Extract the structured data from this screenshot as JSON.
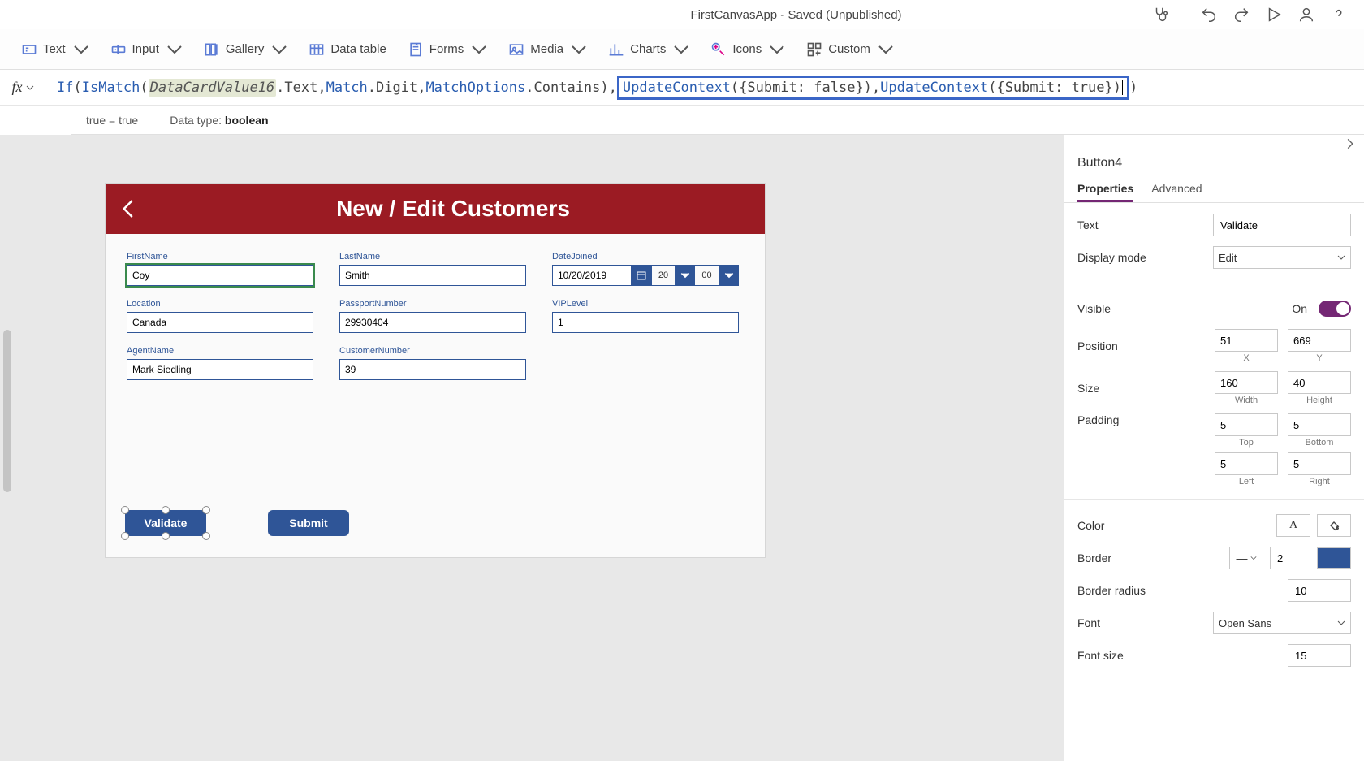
{
  "titlebar": {
    "title": "FirstCanvasApp - Saved (Unpublished)",
    "icons": [
      "stethoscope-icon",
      "undo-icon",
      "redo-icon",
      "play-icon",
      "user-icon",
      "help-icon"
    ]
  },
  "ribbon": {
    "items": [
      {
        "label": "Text",
        "icon": "text-icon"
      },
      {
        "label": "Input",
        "icon": "input-icon"
      },
      {
        "label": "Gallery",
        "icon": "gallery-icon"
      },
      {
        "label": "Data table",
        "icon": "datatable-icon"
      },
      {
        "label": "Forms",
        "icon": "forms-icon"
      },
      {
        "label": "Media",
        "icon": "media-icon"
      },
      {
        "label": "Charts",
        "icon": "charts-icon"
      },
      {
        "label": "Icons",
        "icon": "icons-icon"
      },
      {
        "label": "Custom",
        "icon": "custom-icon"
      }
    ]
  },
  "formula": {
    "tokens": {
      "if": "If",
      "ismatch": "IsMatch",
      "datacard": "DataCardValue16",
      "text": ".Text, ",
      "match": "Match",
      "digit": ".Digit, ",
      "matchoptions": "MatchOptions",
      "contains": ".Contains),",
      "updatecontext1": "UpdateContext",
      "args1": "({Submit: false}), ",
      "updatecontext2": "UpdateContext",
      "args2": "({Submit: true})",
      "close": ")"
    },
    "result_left": "true  =  true",
    "result_right": "Data type: ",
    "result_type": "boolean"
  },
  "canvas": {
    "title": "New / Edit Customers",
    "fields": {
      "firstName": {
        "label": "FirstName",
        "value": "Coy"
      },
      "lastName": {
        "label": "LastName",
        "value": "Smith"
      },
      "dateJoined": {
        "label": "DateJoined",
        "value": "10/20/2019",
        "hour": "20",
        "min": "00"
      },
      "location": {
        "label": "Location",
        "value": "Canada"
      },
      "passport": {
        "label": "PassportNumber",
        "value": "29930404"
      },
      "vip": {
        "label": "VIPLevel",
        "value": "1"
      },
      "agent": {
        "label": "AgentName",
        "value": "Mark Siedling"
      },
      "customerNo": {
        "label": "CustomerNumber",
        "value": "39"
      }
    },
    "buttons": {
      "validate": "Validate",
      "submit": "Submit"
    }
  },
  "props": {
    "name": "Button4",
    "tabs": {
      "properties": "Properties",
      "advanced": "Advanced"
    },
    "text": {
      "label": "Text",
      "value": "Validate"
    },
    "displayMode": {
      "label": "Display mode",
      "value": "Edit"
    },
    "visible": {
      "label": "Visible",
      "value": "On"
    },
    "position": {
      "label": "Position",
      "x": "51",
      "y": "669",
      "xl": "X",
      "yl": "Y"
    },
    "size": {
      "label": "Size",
      "w": "160",
      "h": "40",
      "wl": "Width",
      "hl": "Height"
    },
    "padding": {
      "label": "Padding",
      "top": "5",
      "bottom": "5",
      "left": "5",
      "right": "5",
      "tl": "Top",
      "bl": "Bottom",
      "ll": "Left",
      "rl": "Right"
    },
    "color": {
      "label": "Color",
      "a": "A"
    },
    "border": {
      "label": "Border",
      "value": "2"
    },
    "borderRadius": {
      "label": "Border radius",
      "value": "10"
    },
    "font": {
      "label": "Font",
      "value": "Open Sans"
    },
    "fontSize": {
      "label": "Font size",
      "value": "15"
    }
  }
}
